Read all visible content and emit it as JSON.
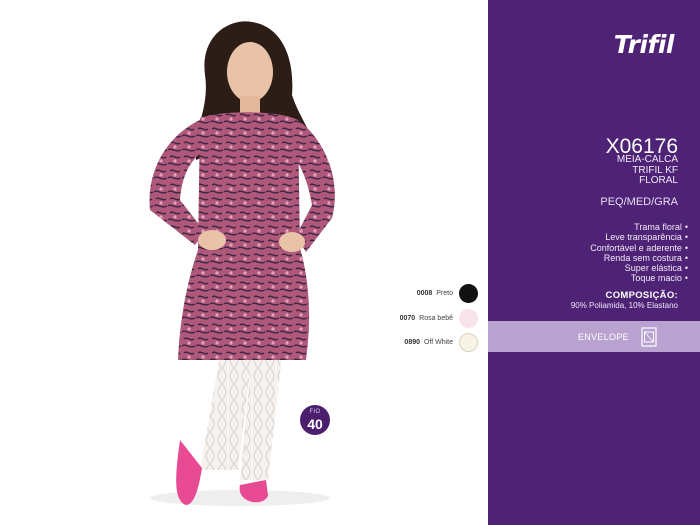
{
  "brand": {
    "name": "Trifil"
  },
  "product": {
    "code": "X06176",
    "name_lines": [
      "MEIA-CALCA",
      "TRIFIL KF",
      "FLORAL"
    ],
    "sizes": "PEQ/MED/GRA"
  },
  "features": [
    "Trama floral",
    "Leve transparência",
    "Confortável e aderente",
    "Renda sem costura",
    "Super elástica",
    "Toque macio"
  ],
  "feature_bullet": "•",
  "composition": {
    "title": "COMPOSIÇÃO:",
    "text": "90% Poliamida, 10% Elastano"
  },
  "packaging": {
    "label": "ENVELOPE",
    "icon": "envelope-package-icon"
  },
  "colors": [
    {
      "code": "0008",
      "name": "Preto",
      "hex": "#111111"
    },
    {
      "code": "0070",
      "name": "Rosa bebê",
      "hex": "#f8e3ea"
    },
    {
      "code": "0890",
      "name": "Off White",
      "hex": "#f7f4e6"
    }
  ],
  "fio": {
    "label": "FIO",
    "value": "40"
  },
  "theme": {
    "panel": "#4e2275",
    "envelope_bar": "#b9a2cf",
    "badge": "#4b1f6e"
  }
}
